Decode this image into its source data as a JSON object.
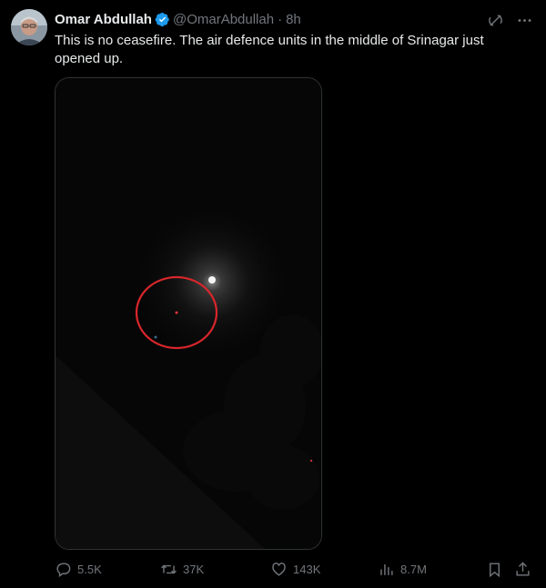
{
  "author": {
    "name": "Omar Abdullah",
    "handle": "@OmarAbdullah",
    "separator": "·",
    "time": "8h",
    "verified": true,
    "verified_color": "#1d9bf0"
  },
  "tweet": {
    "text": "This is no ceasefire. The air defence units in the middle of Srinagar just opened up."
  },
  "top_icons": [
    "grok-icon",
    "more-icon"
  ],
  "actions": {
    "replies": "5.5K",
    "reposts": "37K",
    "likes": "143K",
    "views": "8.7M"
  },
  "colors": {
    "background": "#000000",
    "text": "#e7e9ea",
    "muted": "#71767b",
    "border": "#2f3336",
    "highlight_circle": "#d9262b"
  }
}
